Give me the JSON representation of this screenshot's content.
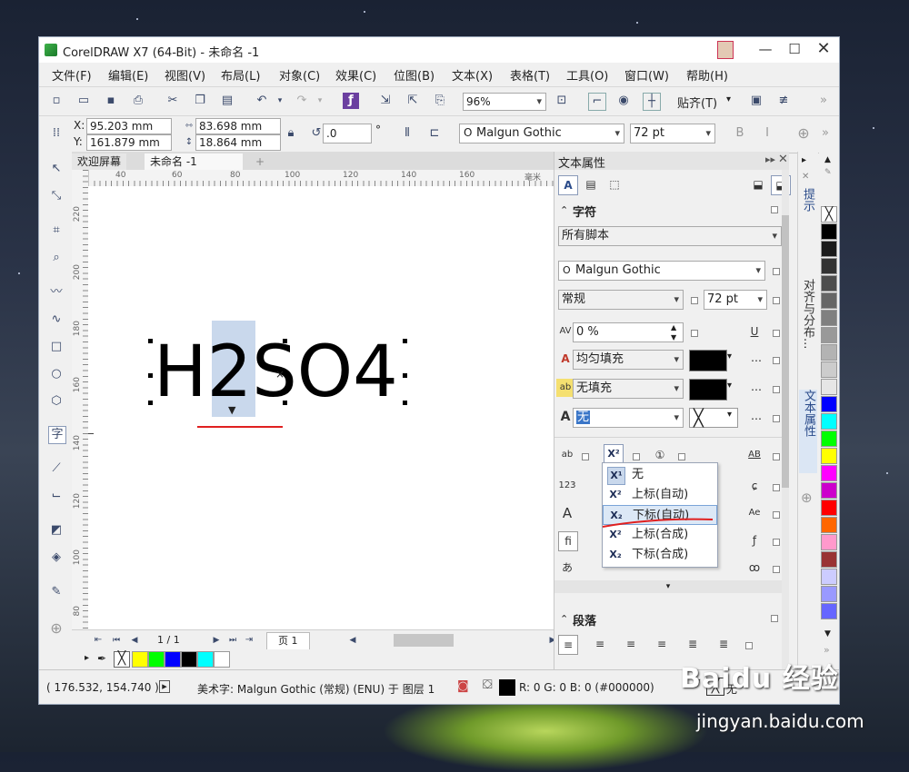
{
  "window": {
    "title": "CorelDRAW X7 (64-Bit) - 未命名 -1"
  },
  "menu": [
    "文件(F)",
    "编辑(E)",
    "视图(V)",
    "布局(L)",
    "对象(C)",
    "效果(C)",
    "位图(B)",
    "文本(X)",
    "表格(T)",
    "工具(O)",
    "窗口(W)",
    "帮助(H)"
  ],
  "toolbar": {
    "zoom": "96%",
    "snap_label": "贴齐(T)"
  },
  "property_bar": {
    "x_label": "X:",
    "x_value": "95.203 mm",
    "y_label": "Y:",
    "y_value": "161.879 mm",
    "width_value": "83.698 mm",
    "height_value": "18.864 mm",
    "angle_value": ".0",
    "angle_unit": "°",
    "font": "Malgun Gothic",
    "font_size": "72 pt"
  },
  "doc_tabs": [
    "欢迎屏幕",
    "未命名 -1"
  ],
  "ruler": {
    "h_labels": [
      "40",
      "60",
      "80",
      "100",
      "120",
      "140",
      "160"
    ],
    "h_unit": "毫米",
    "v_labels": [
      "220",
      "200",
      "180",
      "160",
      "140",
      "120",
      "100",
      "80"
    ]
  },
  "canvas": {
    "text": "H2SO4"
  },
  "pager": {
    "page_count": "1 / 1",
    "page_tab": "页 1"
  },
  "docker": {
    "title": "文本属性",
    "char_section": "字符",
    "script": "所有脚本",
    "font": "Malgun Gothic",
    "style": "常规",
    "size": "72 pt",
    "kerning": "0 %",
    "fill_type": "均匀填充",
    "bg_fill": "无填充",
    "outline": "无",
    "para_section": "段落"
  },
  "position_menu": [
    {
      "icon": "X¹",
      "label": "无"
    },
    {
      "icon": "X²",
      "label": "上标(自动)"
    },
    {
      "icon": "X₂",
      "label": "下标(自动)"
    },
    {
      "icon": "X²",
      "label": "上标(合成)"
    },
    {
      "icon": "X₂",
      "label": "下标(合成)"
    }
  ],
  "side_tabs": [
    "提示",
    "对齐与分布...",
    "文本属性"
  ],
  "palette_colors": [
    "#ffffff",
    "#000000",
    "#1a1a1a",
    "#333333",
    "#4d4d4d",
    "#666666",
    "#808080",
    "#999999",
    "#b3b3b3",
    "#cccccc",
    "#e6e6e6",
    "#0000ff",
    "#00ffff",
    "#00ff00",
    "#ffff00",
    "#ff00ff",
    "#cc00cc",
    "#ff0000",
    "#ff6600",
    "#ff99cc",
    "#993333",
    "#ccccff",
    "#9999ff",
    "#6666ff"
  ],
  "bottom_palette": [
    "#ffffff",
    "#ffff00",
    "#00ff00",
    "#0000ff",
    "#000000",
    "#00ffff",
    "#ffffff"
  ],
  "status": {
    "coords": "( 176.532, 154.740 )",
    "info": "美术字: Malgun Gothic (常规) (ENU) 于 图层 1",
    "color_info": "R: 0 G: 0 B: 0 (#000000)",
    "outline_none": "无"
  },
  "watermark": {
    "brand": "Baidu 经验",
    "url": "jingyan.baidu.com"
  },
  "colors": {
    "accent_blue": "#3a76c8",
    "select_bg": "#c9d8ec",
    "red_mark": "#e02020"
  }
}
